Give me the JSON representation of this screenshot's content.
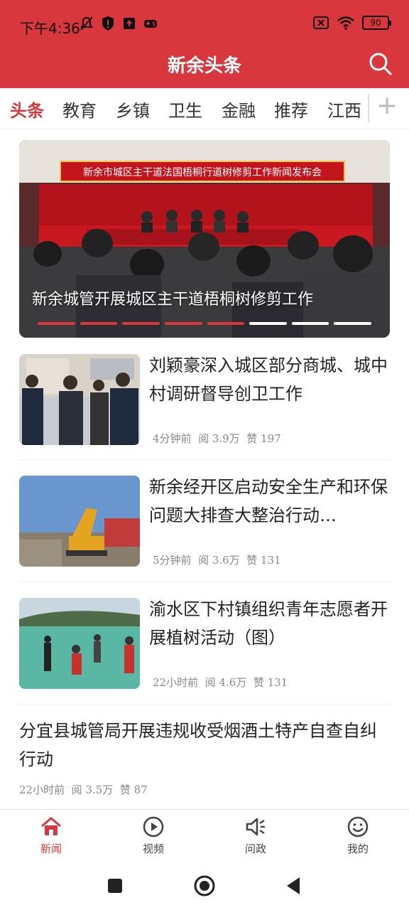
{
  "status_bar": {
    "time": "下午4:36",
    "battery": "90"
  },
  "header": {
    "title": "新余头条"
  },
  "tabs": [
    {
      "label": "头条",
      "active": true
    },
    {
      "label": "教育",
      "active": false
    },
    {
      "label": "乡镇",
      "active": false
    },
    {
      "label": "卫生",
      "active": false
    },
    {
      "label": "金融",
      "active": false
    },
    {
      "label": "推荐",
      "active": false
    },
    {
      "label": "江西",
      "active": false
    }
  ],
  "banner": {
    "caption": "新余城管开展城区主干道梧桐树修剪工作",
    "backdrop_text": "新余市城区主干道法国梧桐行道树修剪工作新闻发布会",
    "slide_count": 8,
    "active_slides": 5
  },
  "news": [
    {
      "title": "刘颖豪深入城区部分商城、城中村调研督导创卫工作",
      "time": "4分钟前",
      "reads": "阅 3.9万",
      "likes": "赞 197"
    },
    {
      "title": "新余经开区启动安全生产和环保问题大排查大整治行动…",
      "time": "5分钟前",
      "reads": "阅 3.6万",
      "likes": "赞 131"
    },
    {
      "title": "渝水区下村镇组织青年志愿者开展植树活动（图）",
      "time": "22小时前",
      "reads": "阅 4.6万",
      "likes": "赞 131"
    },
    {
      "title": "分宜县城管局开展违规收受烟酒土特产自查自纠行动",
      "time": "22小时前",
      "reads": "阅 3.5万",
      "likes": "赞 87"
    }
  ],
  "bottom_nav": [
    {
      "label": "新闻",
      "icon": "home-icon",
      "active": true
    },
    {
      "label": "视频",
      "icon": "play-icon",
      "active": false
    },
    {
      "label": "问政",
      "icon": "megaphone-icon",
      "active": false
    },
    {
      "label": "我的",
      "icon": "smiley-icon",
      "active": false
    }
  ],
  "colors": {
    "brand": "#d8373d",
    "text": "#222222",
    "meta": "#888888"
  }
}
